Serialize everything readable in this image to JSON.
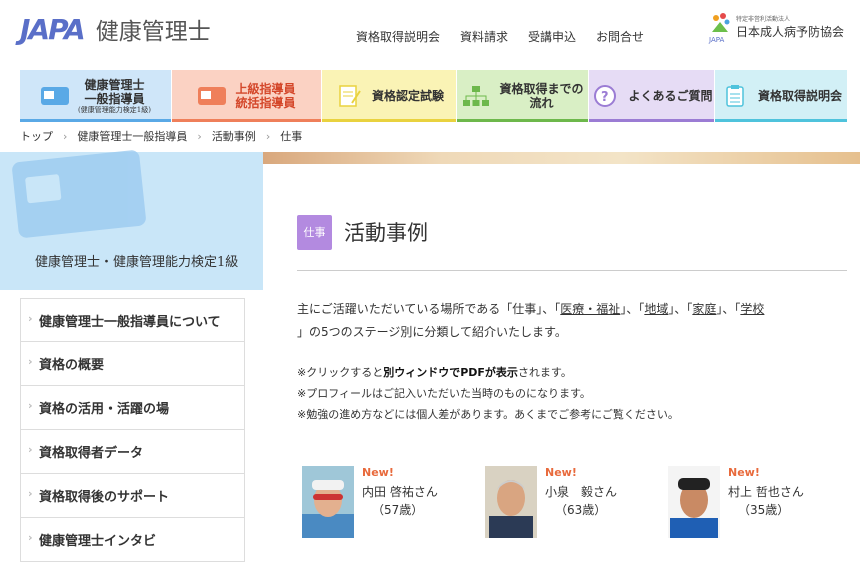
{
  "header": {
    "logo_mark": "JAPA",
    "logo_text": "健康管理士",
    "nav": [
      "資格取得説明会",
      "資料請求",
      "受講申込",
      "お問合せ"
    ],
    "org_small": "特定非営利活動法人",
    "org_name": "日本成人病予防協会",
    "org_abbr": "JAPA"
  },
  "global_nav": [
    {
      "line1": "健康管理士",
      "line2": "一般指導員",
      "line3": "(健康管理能力検定1級)",
      "bg": "#cfe6f9",
      "bar": "#5aa9e6",
      "icon": "card-icon",
      "color": "#333"
    },
    {
      "line1": "上級指導員",
      "line2": "統括指導員",
      "line3": "",
      "bg": "#fbd2c3",
      "bar": "#ef7f5a",
      "icon": "card-icon",
      "color": "#d4472a"
    },
    {
      "line1": "資格認定試験",
      "line2": "",
      "line3": "",
      "bg": "#faf3b5",
      "bar": "#e9d23f",
      "icon": "document-pen-icon",
      "color": "#333"
    },
    {
      "line1": "資格取得までの",
      "line2": "流れ",
      "line3": "",
      "bg": "#d9efc5",
      "bar": "#6db84b",
      "icon": "flowchart-icon",
      "color": "#333"
    },
    {
      "line1": "よくあるご質問",
      "line2": "",
      "line3": "",
      "bg": "#e6dcf5",
      "bar": "#9b7cd4",
      "icon": "question-icon",
      "color": "#333"
    },
    {
      "line1": "資格取得説明会",
      "line2": "",
      "line3": "",
      "bg": "#d2f0f6",
      "bar": "#4fc3dc",
      "icon": "clipboard-icon",
      "color": "#333"
    }
  ],
  "breadcrumb": [
    "トップ",
    "健康管理士一般指導員",
    "活動事例",
    "仕事"
  ],
  "sidebar": {
    "title": "健康管理士・健康管理能力検定1級",
    "items": [
      "健康管理士一般指導員について",
      "資格の概要",
      "資格の活用・活躍の場",
      "資格取得者データ",
      "資格取得後のサポート",
      "健康管理士インタビ"
    ]
  },
  "main": {
    "tag": "仕事",
    "title": "活動事例",
    "intro_pre": "主にご活躍いただいている場所である「仕事」、「",
    "links": [
      "医療・福祉",
      "地域",
      "家庭",
      "学校"
    ],
    "intro_mid1": "」、「",
    "intro_post": "」の5つのステージ別に分類して紹介いたします。",
    "note1_pre": "※クリックすると",
    "note1_bold": "別ウィンドウでPDFが表示",
    "note1_post": "されます。",
    "note2": "※プロフィールはご記入いただいた当時のものになります。",
    "note3": "※勉強の進め方などには個人差があります。あくまでご参考にご覧ください。"
  },
  "people": [
    {
      "new": "New!",
      "name": "内田 啓祐さん",
      "age": "（57歳）"
    },
    {
      "new": "New!",
      "name": "小泉　毅さん",
      "age": "（63歳）"
    },
    {
      "new": "New!",
      "name": "村上 哲也さん",
      "age": "（35歳）"
    }
  ]
}
